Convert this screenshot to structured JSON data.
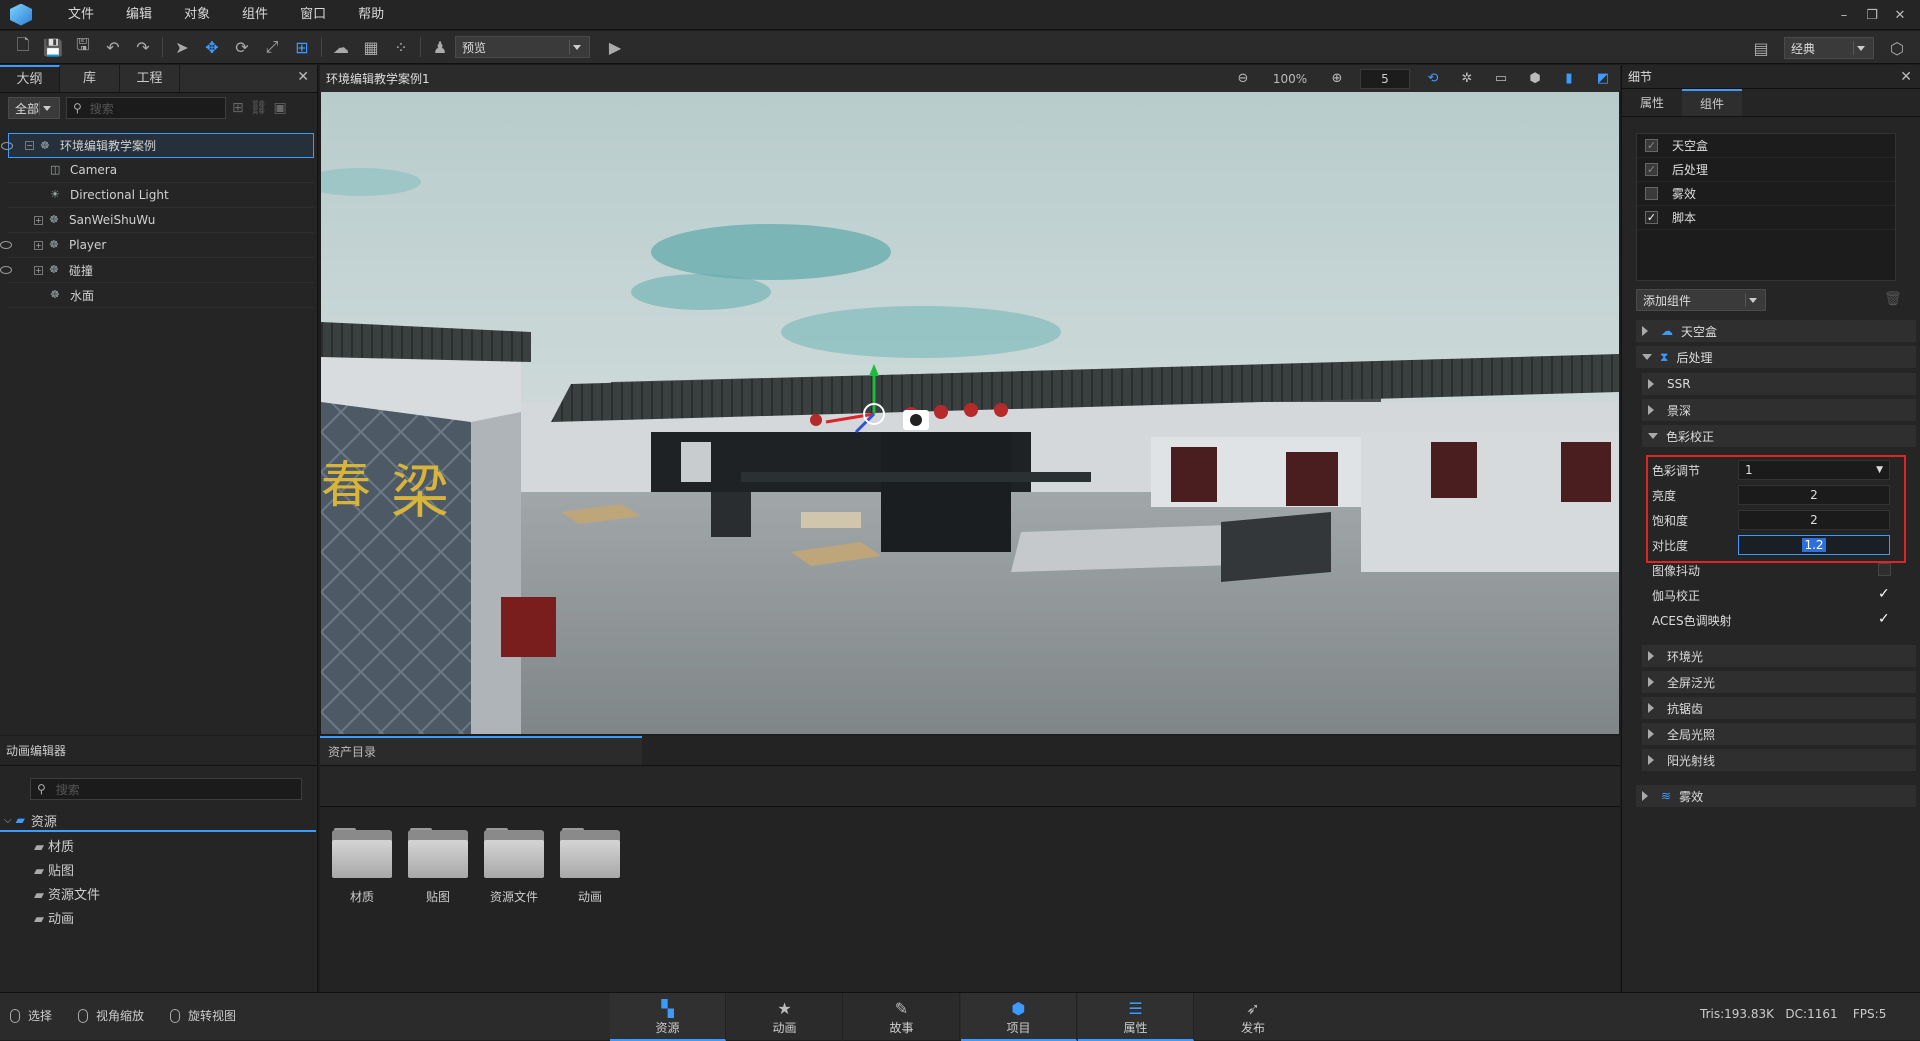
{
  "menubar": {
    "items": [
      "文件",
      "编辑",
      "对象",
      "组件",
      "窗口",
      "帮助"
    ]
  },
  "toolbar": {
    "mode_select": "预览",
    "layout_select": "经典"
  },
  "outline": {
    "tabs": [
      "大纲",
      "库",
      "工程"
    ],
    "filter": "全部",
    "search_placeholder": "搜索",
    "tree": [
      {
        "label": "环境编辑教学案例",
        "level": 0,
        "expander": "⊟",
        "selected": true,
        "eye": true
      },
      {
        "label": "Camera",
        "level": 1,
        "icon": "camera-icon"
      },
      {
        "label": "Directional Light",
        "level": 1,
        "icon": "light-icon"
      },
      {
        "label": "SanWeiShuWu",
        "level": 1,
        "expander": "⊞",
        "icon": "group-icon"
      },
      {
        "label": "Player",
        "level": 1,
        "expander": "⊞",
        "icon": "group-icon",
        "eye": true
      },
      {
        "label": "碰撞",
        "level": 1,
        "expander": "⊞",
        "icon": "group-icon",
        "eye": true
      },
      {
        "label": "水面",
        "level": 1,
        "icon": "group-icon"
      }
    ]
  },
  "viewport": {
    "title": "环境编辑教学案例1",
    "zoom": "100%",
    "speed": "5"
  },
  "details": {
    "title": "细节",
    "tabs": [
      "属性",
      "组件"
    ],
    "components": [
      {
        "label": "天空盒",
        "checked": true
      },
      {
        "label": "后处理",
        "checked": true
      },
      {
        "label": "雾效",
        "checked": false
      },
      {
        "label": "脚本",
        "checked": true
      }
    ],
    "add_component": "添加组件",
    "sections": {
      "skybox": "天空盒",
      "post": "后处理",
      "ssr": "SSR",
      "dof": "景深",
      "color": "色彩校正",
      "ambient": "环境光",
      "bloom": "全屏泛光",
      "aa": "抗锯齿",
      "gi": "全局光照",
      "sunrays": "阳光射线",
      "fog": "雾效"
    },
    "color_props": {
      "adjust_label": "色彩调节",
      "adjust_value": "1",
      "brightness_label": "亮度",
      "brightness_value": "2",
      "saturation_label": "饱和度",
      "saturation_value": "2",
      "contrast_label": "对比度",
      "contrast_value": "1.2",
      "jitter_label": "图像抖动",
      "gamma_label": "伽马校正",
      "aces_label": "ACES色调映射"
    }
  },
  "anim": {
    "title": "动画编辑器",
    "search_placeholder": "搜索",
    "root": "资源",
    "children": [
      "材质",
      "贴图",
      "资源文件",
      "动画"
    ]
  },
  "assets": {
    "tab": "资产目录",
    "folders": [
      "材质",
      "贴图",
      "资源文件",
      "动画"
    ]
  },
  "status": {
    "hints": [
      "选择",
      "视角缩放",
      "旋转视图"
    ],
    "nav": [
      "资源",
      "动画",
      "故事",
      "项目",
      "属性",
      "发布"
    ],
    "stats": "Tris:193.83K   DC:1161    FPS:5"
  }
}
